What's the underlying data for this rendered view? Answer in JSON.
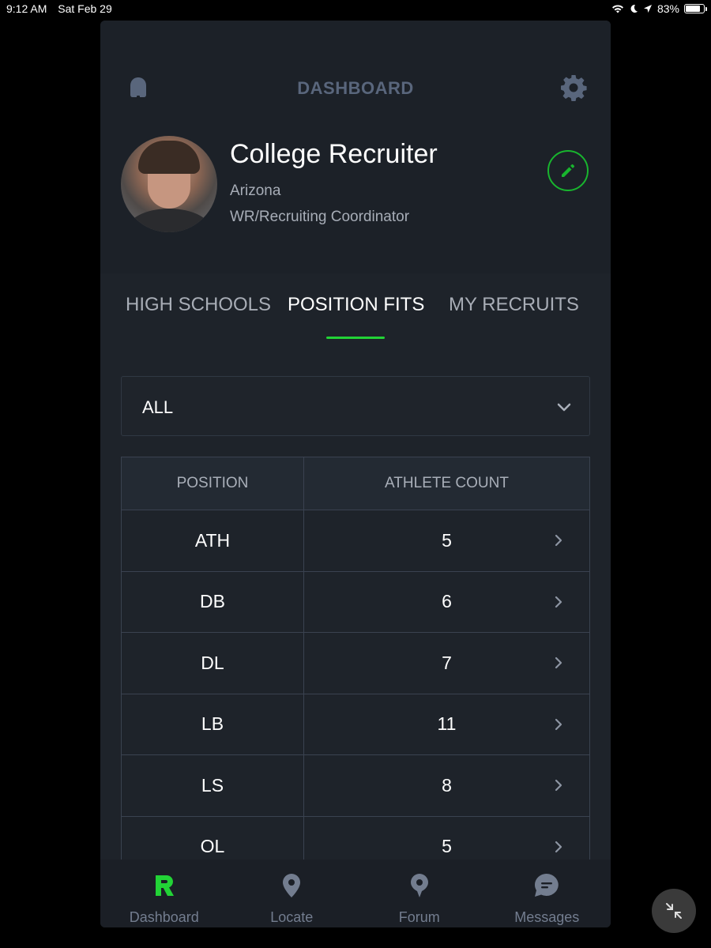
{
  "status_bar": {
    "time": "9:12 AM",
    "date": "Sat Feb 29",
    "battery": "83%",
    "battery_level": 0.83
  },
  "header": {
    "title": "DASHBOARD",
    "left_icon": "bell-icon",
    "right_icon": "gear-icon"
  },
  "profile": {
    "name": "College Recruiter",
    "location": "Arizona",
    "role": "WR/Recruiting Coordinator",
    "edit_icon": "pencil-icon",
    "accent_color": "#18b52e"
  },
  "tabs": [
    {
      "label": "HIGH SCHOOLS",
      "active": false
    },
    {
      "label": "POSITION FITS",
      "active": true
    },
    {
      "label": "MY RECRUITS",
      "active": false
    }
  ],
  "filter": {
    "selected": "ALL"
  },
  "table": {
    "headers": [
      "POSITION",
      "ATHLETE COUNT"
    ],
    "rows": [
      {
        "position": "ATH",
        "count": "5"
      },
      {
        "position": "DB",
        "count": "6"
      },
      {
        "position": "DL",
        "count": "7"
      },
      {
        "position": "LB",
        "count": "11"
      },
      {
        "position": "LS",
        "count": "8"
      },
      {
        "position": "OL",
        "count": "5"
      }
    ]
  },
  "bottom_nav": [
    {
      "label": "Dashboard",
      "icon": "r-logo-icon",
      "active": true
    },
    {
      "label": "Locate",
      "icon": "map-pin-icon",
      "active": false
    },
    {
      "label": "Forum",
      "icon": "map-pin-icon",
      "active": false
    },
    {
      "label": "Messages",
      "icon": "chat-bubble-icon",
      "active": false
    }
  ],
  "colors": {
    "brand_green": "#22d336",
    "background": "#1e232a"
  }
}
